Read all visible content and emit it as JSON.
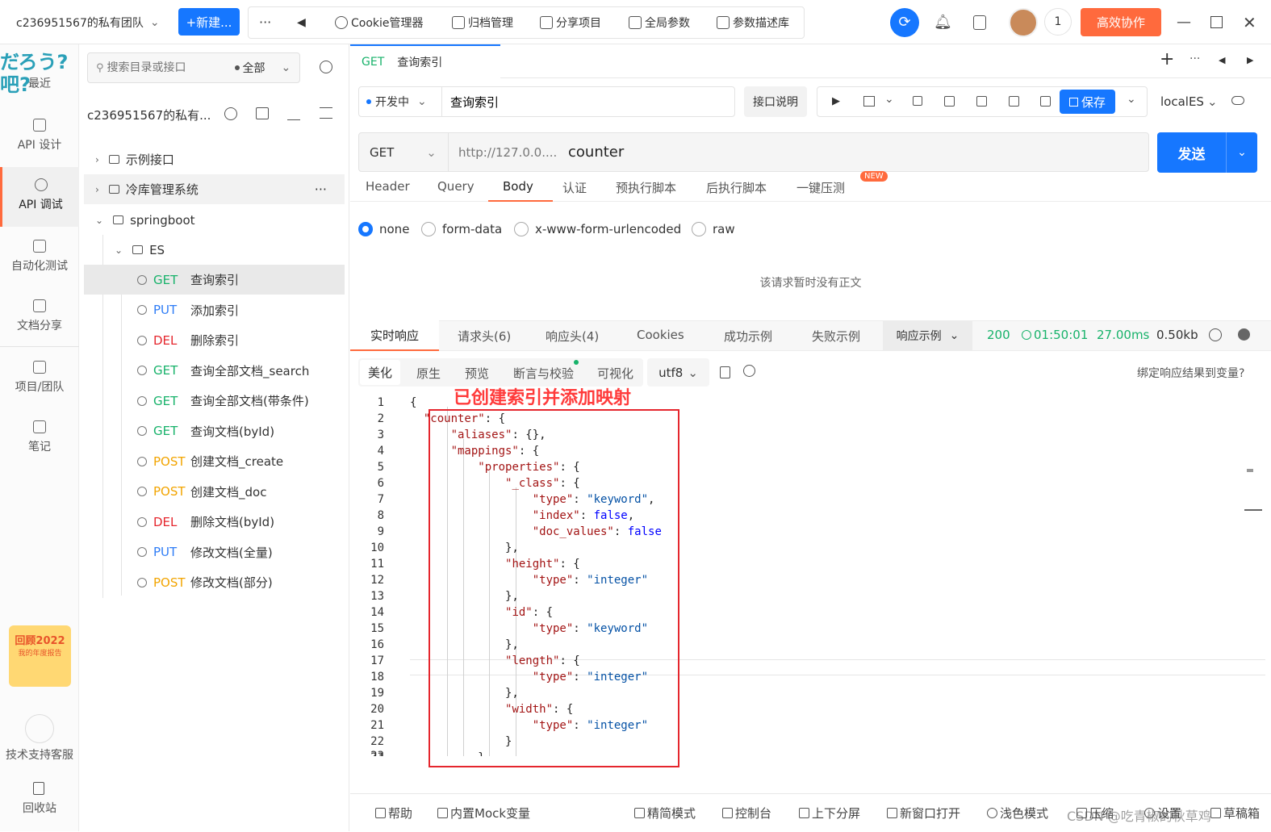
{
  "topbar": {
    "team": "c236951567的私有团队",
    "new_button": "+新建...",
    "more": "···",
    "back": "◀",
    "items": [
      "Cookie管理器",
      "归档管理",
      "分享项目",
      "全局参数",
      "参数描述库"
    ],
    "notifications": "1",
    "collab_button": "高效协作"
  },
  "rail": {
    "logo_text": "だろう?吧?",
    "items": [
      {
        "label": "最近"
      },
      {
        "label": "API 设计"
      },
      {
        "label": "API 调试"
      },
      {
        "label": "自动化测试"
      },
      {
        "label": "文档分享"
      },
      {
        "label": "项目/团队"
      },
      {
        "label": "笔记"
      }
    ],
    "banner": "回顾2022",
    "banner_sub": "我的年度报告",
    "support": "技术支持客服",
    "trash": "回收站"
  },
  "tree": {
    "search_placeholder": "搜索目录或接口",
    "filter": "全部",
    "project": "c236951567的私有...",
    "nodes": [
      {
        "type": "folder",
        "label": "示例接口"
      },
      {
        "type": "folder",
        "label": "冷库管理系统",
        "more": "···"
      },
      {
        "type": "folder",
        "label": "springboot"
      },
      {
        "type": "folder",
        "label": "ES"
      },
      {
        "type": "api",
        "method": "GET",
        "label": "查询索引"
      },
      {
        "type": "api",
        "method": "PUT",
        "label": "添加索引"
      },
      {
        "type": "api",
        "method": "DEL",
        "label": "删除索引"
      },
      {
        "type": "api",
        "method": "GET",
        "label": "查询全部文档_search"
      },
      {
        "type": "api",
        "method": "GET",
        "label": "查询全部文档(带条件)"
      },
      {
        "type": "api",
        "method": "GET",
        "label": "查询文档(byId)"
      },
      {
        "type": "api",
        "method": "POST",
        "label": "创建文档_create"
      },
      {
        "type": "api",
        "method": "POST",
        "label": "创建文档_doc"
      },
      {
        "type": "api",
        "method": "DEL",
        "label": "删除文档(byId)"
      },
      {
        "type": "api",
        "method": "PUT",
        "label": "修改文档(全量)"
      },
      {
        "type": "api",
        "method": "POST",
        "label": "修改文档(部分)"
      }
    ]
  },
  "main": {
    "tab_method": "GET",
    "tab_title": "查询索引",
    "status": "开发中",
    "api_name": "查询索引",
    "doc_button": "接口说明",
    "save_button": "保存",
    "env": "localES",
    "method": "GET",
    "url_base": "http://127.0.0....",
    "url_path": "counter",
    "send": "发送",
    "req_tabs": [
      "Header",
      "Query",
      "Body",
      "认证",
      "预执行脚本",
      "后执行脚本",
      "一键压测"
    ],
    "new_badge": "NEW",
    "body_types": [
      "none",
      "form-data",
      "x-www-form-urlencoded",
      "raw"
    ],
    "empty_body": "该请求暂时没有正文",
    "resp_tabs": [
      "实时响应",
      "请求头(6)",
      "响应头(4)",
      "Cookies",
      "成功示例",
      "失败示例"
    ],
    "resp_example": "响应示例",
    "status_code": "200",
    "time": "01:50:01",
    "duration": "27.00ms",
    "size": "0.50kb",
    "view_tabs": [
      "美化",
      "原生",
      "预览",
      "断言与校验",
      "可视化"
    ],
    "encoding": "utf8",
    "bind_var": "绑定响应结果到变量?",
    "annotation": "已创建索引并添加映射",
    "bottom": [
      "帮助",
      "内置Mock变量",
      "精简模式",
      "控制台",
      "上下分屏",
      "新窗口打开",
      "浅色模式",
      "压缩",
      "设置",
      "草稿箱"
    ],
    "watermark": "CSDN @吃青椒的秋草鸡"
  },
  "code_lines": [
    "{",
    "  \"counter\": {",
    "      \"aliases\": {},",
    "      \"mappings\": {",
    "          \"properties\": {",
    "              \"_class\": {",
    "                  \"type\": \"keyword\",",
    "                  \"index\": false,",
    "                  \"doc_values\": false",
    "              },",
    "              \"height\": {",
    "                  \"type\": \"integer\"",
    "              },",
    "              \"id\": {",
    "                  \"type\": \"keyword\"",
    "              },",
    "              \"length\": {",
    "                  \"type\": \"integer\"",
    "              },",
    "              \"width\": {",
    "                  \"type\": \"integer\"",
    "              }",
    "          }"
  ]
}
